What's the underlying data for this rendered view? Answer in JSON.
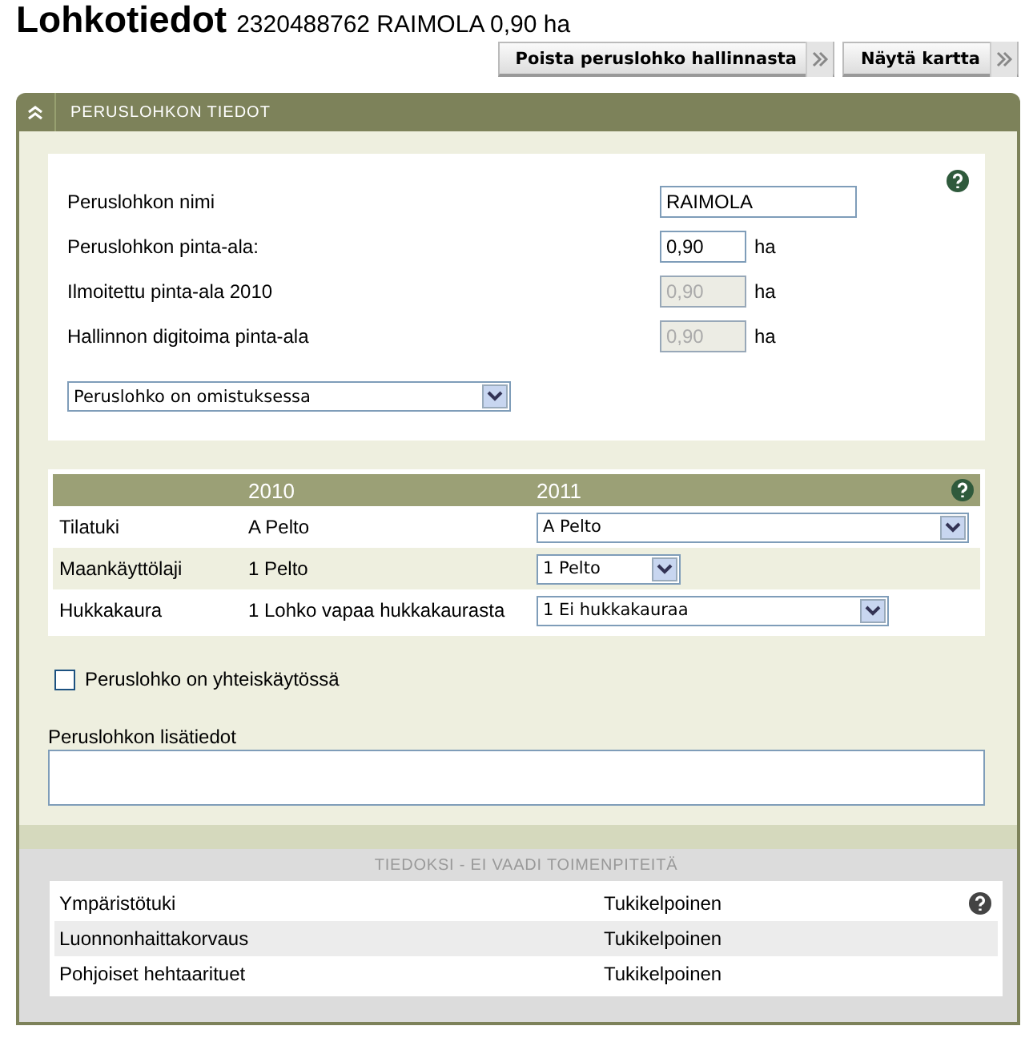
{
  "page": {
    "title": "Lohkotiedot",
    "subtitle": "2320488762 RAIMOLA 0,90 ha"
  },
  "actions": [
    {
      "label": "Poista peruslohko hallinnasta"
    },
    {
      "label": "Näytä kartta"
    }
  ],
  "panel": {
    "title": "PERUSLOHKON TIEDOT",
    "expanded": true
  },
  "fields": [
    {
      "label": "Peruslohkon nimi",
      "value": "RAIMOLA",
      "disabled": false,
      "kind": "wide"
    },
    {
      "label": "Peruslohkon pinta-ala:",
      "value": "0,90",
      "unit": "ha",
      "disabled": false,
      "kind": "short"
    },
    {
      "label": "Ilmoitettu pinta-ala 2010",
      "value": "0,90",
      "unit": "ha",
      "disabled": true,
      "kind": "short"
    },
    {
      "label": "Hallinnon digitoima pinta-ala",
      "value": "0,90",
      "unit": "ha",
      "disabled": true,
      "kind": "short"
    }
  ],
  "ownership_select": {
    "value": "Peruslohko on omistuksessa"
  },
  "table": {
    "columns": [
      "2010",
      "2011"
    ],
    "rows": [
      {
        "label": "Tilatuki",
        "value_2010": "A Pelto",
        "select": "A Pelto",
        "kind": "large"
      },
      {
        "label": "Maankäyttölaji",
        "value_2010": "1 Pelto",
        "select": "1 Pelto",
        "kind": "small"
      },
      {
        "label": "Hukkakaura",
        "value_2010": "1 Lohko vapaa hukkakaurasta",
        "select": "1 Ei hukkakauraa",
        "kind": "medium"
      }
    ]
  },
  "shared_checkbox": {
    "label": "Peruslohko on yhteiskäytössä",
    "checked": false
  },
  "notes": {
    "label": "Peruslohkon lisätiedot"
  },
  "info": {
    "title": "TIEDOKSI - EI VAADI TOIMENPITEITÄ",
    "rows": [
      {
        "label": "Ympäristötuki",
        "status": "Tukikelpoinen"
      },
      {
        "label": "Luonnonhaittakorvaus",
        "status": "Tukikelpoinen"
      },
      {
        "label": "Pohjoiset hehtaarituet",
        "status": "Tukikelpoinen"
      }
    ]
  }
}
